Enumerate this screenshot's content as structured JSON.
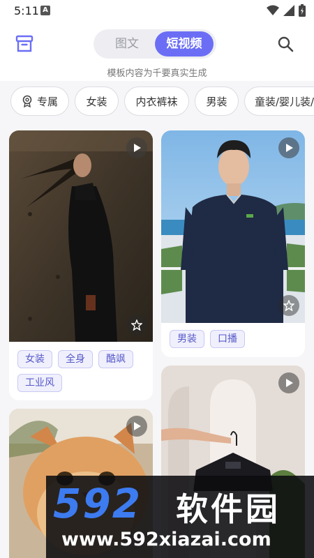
{
  "status": {
    "time": "5:11",
    "notification_letter": "A"
  },
  "header": {
    "tabs": [
      {
        "label": "图文"
      },
      {
        "label": "短视频"
      }
    ],
    "subtitle": "模板内容为千要真实生成"
  },
  "categories": [
    {
      "label": "专属",
      "icon": "badge-icon"
    },
    {
      "label": "女装"
    },
    {
      "label": "内衣裤袜"
    },
    {
      "label": "男装"
    },
    {
      "label": "童装/婴儿装/"
    }
  ],
  "cards": [
    {
      "tags": [
        "女装",
        "全身",
        "酷飒",
        "工业风"
      ]
    },
    {
      "tags": [
        "男装",
        "口播"
      ]
    },
    {
      "tags": []
    },
    {
      "tags": []
    }
  ],
  "watermark": {
    "logo": "592",
    "name": "软件园",
    "url": "www.592xiazai.com"
  },
  "colors": {
    "accent": "#6b6ef5",
    "tag_text": "#5658c8",
    "tag_bg": "#f0f0fd"
  }
}
